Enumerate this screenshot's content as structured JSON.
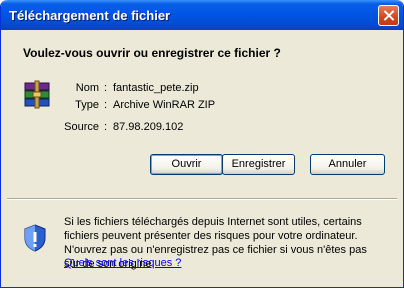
{
  "window": {
    "title": "Téléchargement de fichier"
  },
  "question": "Voulez-vous ouvrir ou enregistrer ce fichier ?",
  "details": {
    "name_label": "Nom",
    "name_value": "fantastic_pete.zip",
    "type_label": "Type",
    "type_value": "Archive WinRAR ZIP",
    "source_label": "Source",
    "source_value": "87.98.209.102",
    "separator": ":"
  },
  "buttons": {
    "open": "Ouvrir",
    "save": "Enregistrer",
    "cancel": "Annuler"
  },
  "warning": {
    "text": "Si les fichiers téléchargés depuis Internet sont utiles, certains fichiers peuvent présenter des risques pour votre ordinateur. N'ouvrez pas ou n'enregistrez pas ce fichier si vous n'êtes pas sûr de son origine.",
    "link": "Quels sont les risques ?"
  },
  "icons": {
    "file": "winrar-archive-icon",
    "warning": "security-shield-icon",
    "close": "close-icon"
  },
  "colors": {
    "titlebar": "#0055e5",
    "dialog_bg": "#ece9d8",
    "close": "#d0471f",
    "link": "#0000ff"
  }
}
